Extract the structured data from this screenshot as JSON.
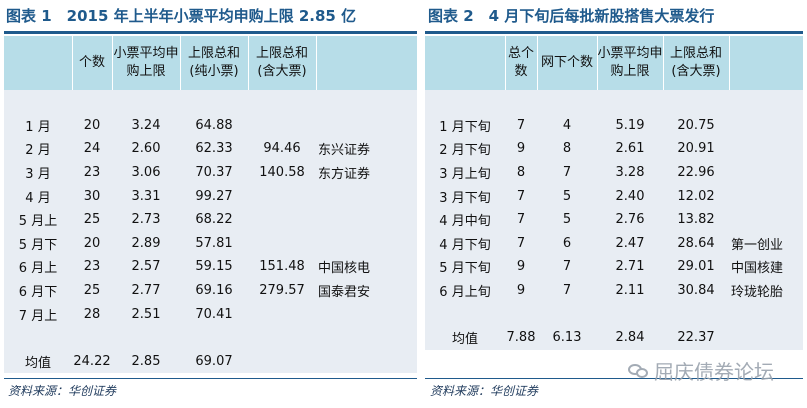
{
  "table1": {
    "title": "图表 1　2015 年上半年小票平均申购上限 2.85 亿",
    "headers": [
      "",
      "个数",
      "小票平均申购上限",
      "上限总和(纯小票)",
      "上限总和(含大票)",
      ""
    ],
    "rows": [
      [
        "1 月",
        "20",
        "3.24",
        "64.88",
        "",
        ""
      ],
      [
        "2 月",
        "24",
        "2.60",
        "62.33",
        "94.46",
        "东兴证券"
      ],
      [
        "3 月",
        "23",
        "3.06",
        "70.37",
        "140.58",
        "东方证券"
      ],
      [
        "4 月",
        "30",
        "3.31",
        "99.27",
        "",
        ""
      ],
      [
        "5 月上",
        "25",
        "2.73",
        "68.22",
        "",
        ""
      ],
      [
        "5 月下",
        "20",
        "2.89",
        "57.81",
        "",
        ""
      ],
      [
        "6 月上",
        "23",
        "2.57",
        "59.15",
        "151.48",
        "中国核电"
      ],
      [
        "6 月下",
        "25",
        "2.77",
        "69.16",
        "279.57",
        "国泰君安"
      ],
      [
        "7 月上",
        "28",
        "2.51",
        "70.41",
        "",
        ""
      ]
    ],
    "summary": [
      "均值",
      "24.22",
      "2.85",
      "69.07",
      "",
      ""
    ],
    "source": "资料来源：华创证券"
  },
  "table2": {
    "title": "图表 2　4 月下旬后每批新股搭售大票发行",
    "headers": [
      "",
      "总个数",
      "网下个数",
      "小票平均申购上限",
      "上限总和(含大票)",
      ""
    ],
    "rows": [
      [
        "1 月下旬",
        "7",
        "4",
        "5.19",
        "20.75",
        ""
      ],
      [
        "2 月下旬",
        "9",
        "8",
        "2.61",
        "20.91",
        ""
      ],
      [
        "3 月上旬",
        "8",
        "7",
        "3.28",
        "22.96",
        ""
      ],
      [
        "3 月下旬",
        "7",
        "5",
        "2.40",
        "12.02",
        ""
      ],
      [
        "4 月中旬",
        "7",
        "5",
        "2.76",
        "13.82",
        ""
      ],
      [
        "4 月下旬",
        "7",
        "6",
        "2.47",
        "28.64",
        "第一创业"
      ],
      [
        "5 月下旬",
        "9",
        "7",
        "2.71",
        "29.01",
        "中国核建"
      ],
      [
        "6 月上旬",
        "9",
        "7",
        "2.11",
        "30.84",
        "玲珑轮胎"
      ]
    ],
    "summary": [
      "均值",
      "7.88",
      "6.13",
      "2.84",
      "22.37",
      ""
    ],
    "source": "资料来源：华创证券"
  },
  "watermark": {
    "text": "屈庆债券论坛",
    "icon": "chat-bubbles-icon"
  }
}
